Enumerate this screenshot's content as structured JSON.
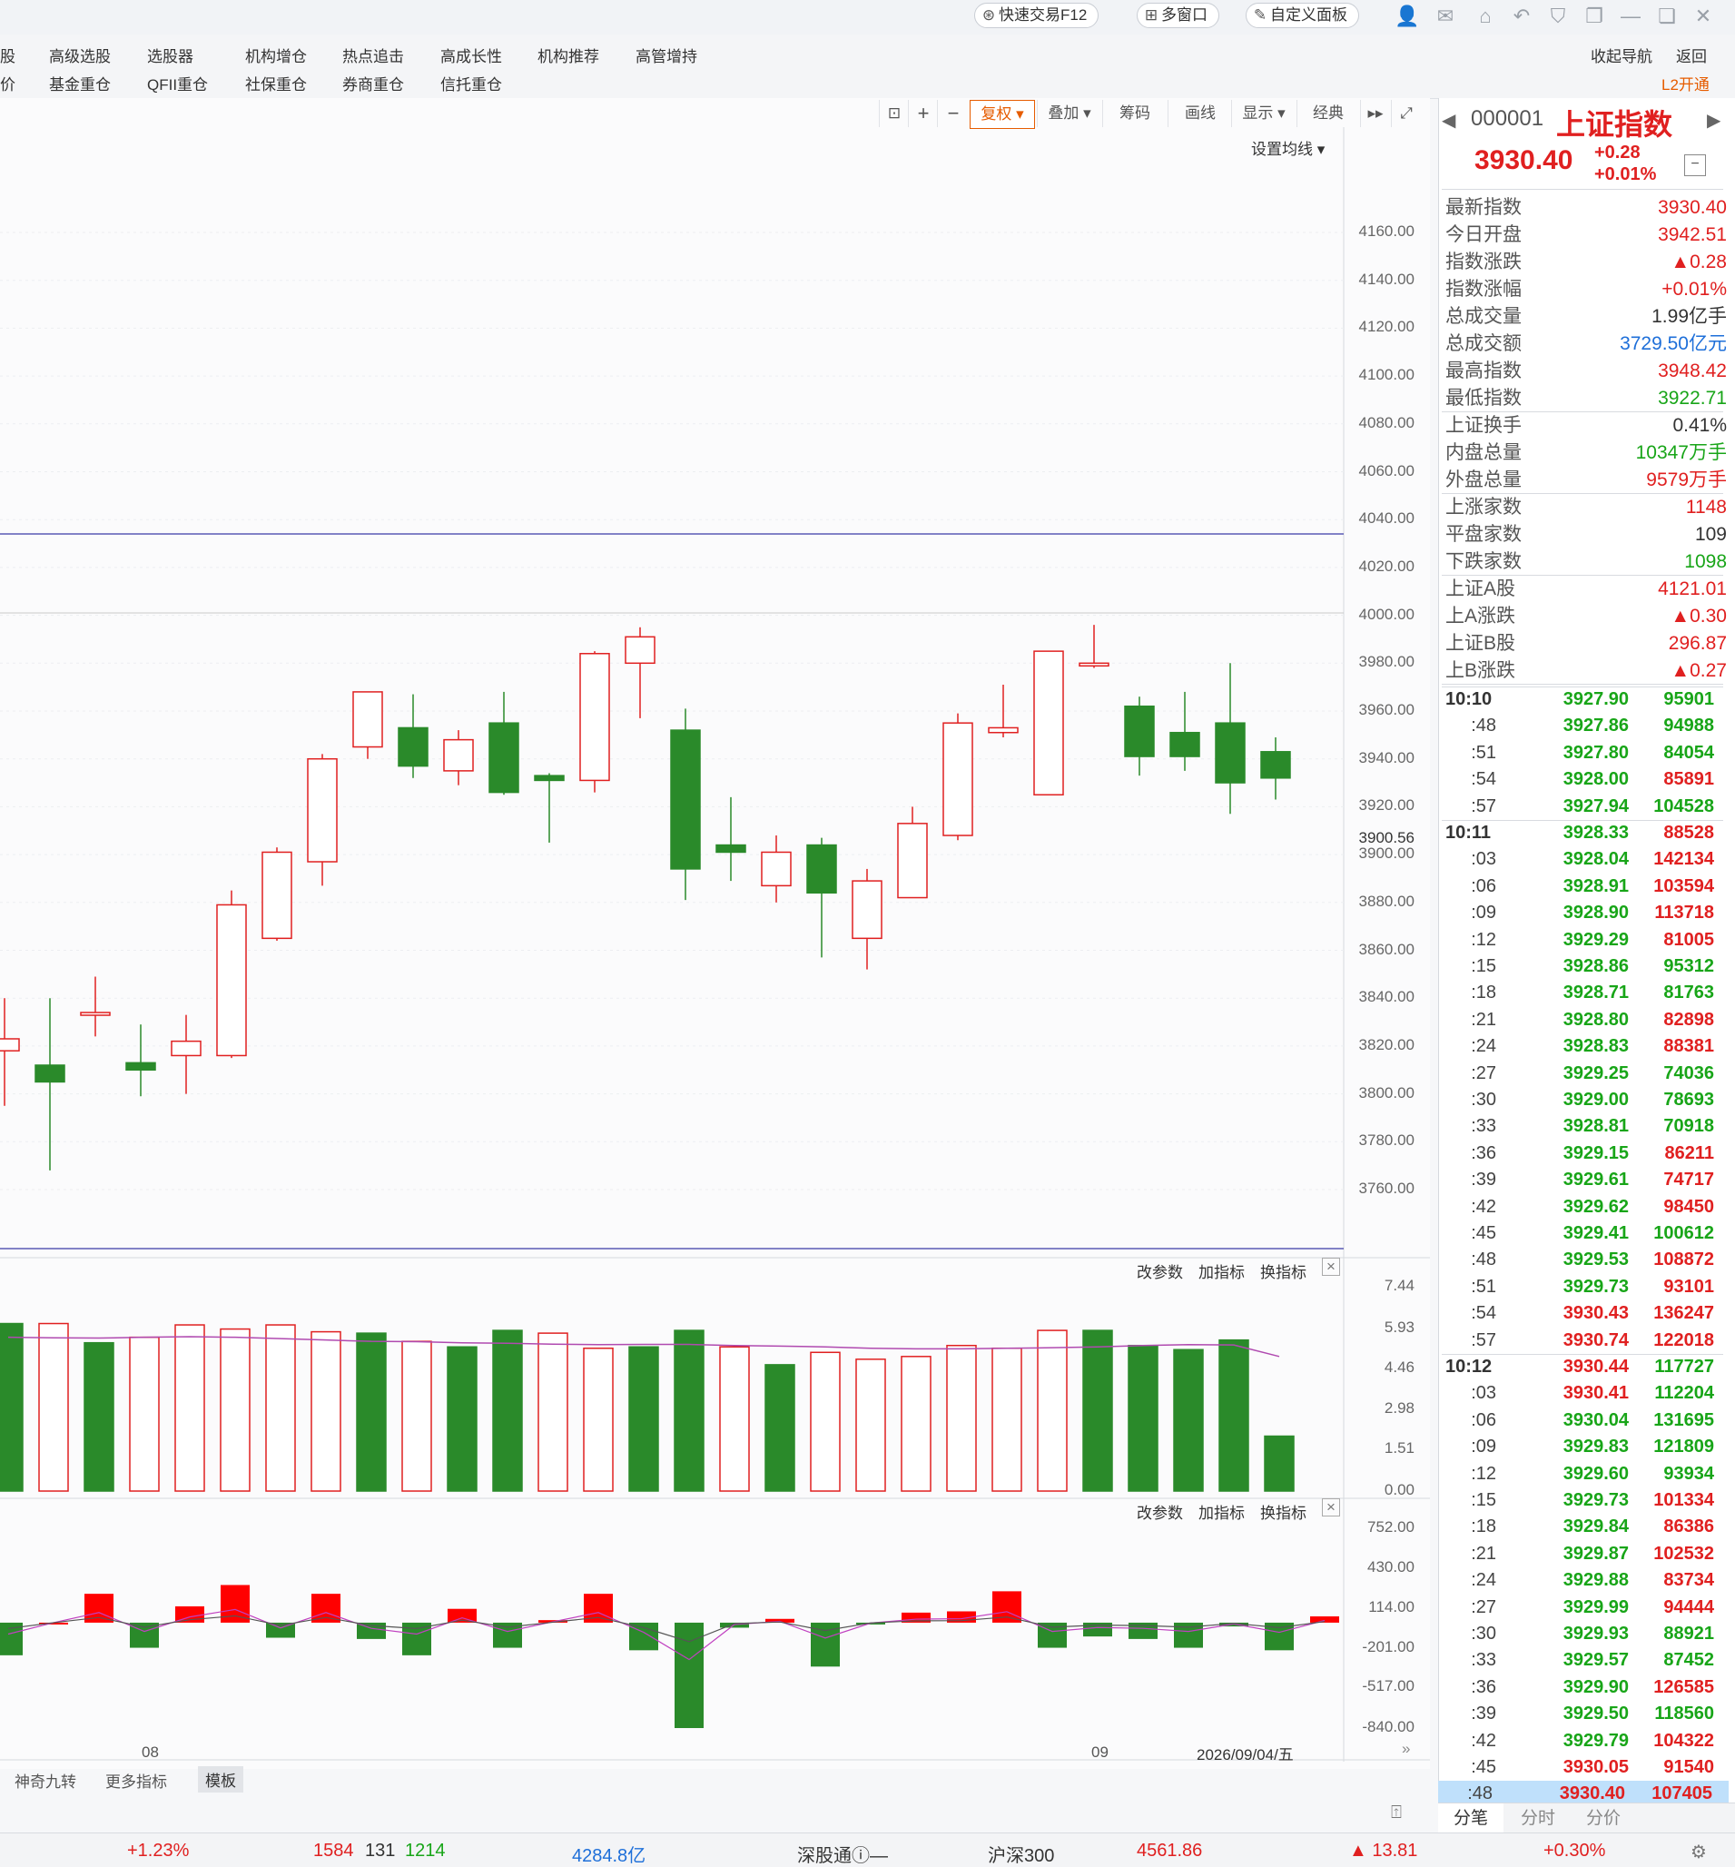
{
  "titlebar": {
    "quick_trade": "快速交易F12",
    "multi_window": "多窗口",
    "custom_panel": "自定义面板"
  },
  "menu": {
    "row1": [
      "股",
      "高级选股",
      "选股器",
      "机构增仓",
      "热点追击",
      "高成长性",
      "机构推荐",
      "高管增持"
    ],
    "row2": [
      "价",
      "基金重仓",
      "QFII重仓",
      "社保重仓",
      "券商重仓",
      "信托重仓"
    ],
    "right1": [
      "收起导航",
      "返回"
    ],
    "l2": "L2开通"
  },
  "toolbar": {
    "fuquan": "复权",
    "diejia": "叠加",
    "chouma": "筹码",
    "huaxian": "画线",
    "xianshi": "显示",
    "jingdian": "经典",
    "set_ma": "设置均线"
  },
  "colors": {
    "up": "#e02020",
    "down": "#2a8a2a",
    "accent": "#e65c00"
  },
  "chart_data": [
    {
      "type": "candlestick",
      "title": "",
      "ylim": [
        3745,
        4170
      ],
      "y_ticks": [
        "4160.00",
        "4140.00",
        "4120.00",
        "4100.00",
        "4080.00",
        "4060.00",
        "4040.00",
        "4020.00",
        "4000.00",
        "3980.00",
        "3960.00",
        "3940.00",
        "3920.00",
        "3900.00",
        "3880.00",
        "3860.00",
        "3840.00",
        "3820.00",
        "3800.00",
        "3780.00",
        "3760.00"
      ],
      "last_price_label": "3900.56",
      "x_labels": [
        "08",
        "09",
        "2026/09/04/五"
      ],
      "candles": [
        {
          "open": 3818,
          "close": 3823,
          "high": 3840,
          "low": 3795
        },
        {
          "open": 3812,
          "close": 3805,
          "high": 3840,
          "low": 3768
        },
        {
          "open": 3834,
          "close": 3834,
          "high": 3849,
          "low": 3824
        },
        {
          "open": 3813,
          "close": 3810,
          "high": 3829,
          "low": 3799
        },
        {
          "open": 3816,
          "close": 3822,
          "high": 3833,
          "low": 3800
        },
        {
          "open": 3816,
          "close": 3879,
          "high": 3885,
          "low": 3815
        },
        {
          "open": 3865,
          "close": 3901,
          "high": 3903,
          "low": 3864
        },
        {
          "open": 3897,
          "close": 3940,
          "high": 3942,
          "low": 3887
        },
        {
          "open": 3945,
          "close": 3968,
          "high": 3968,
          "low": 3940
        },
        {
          "open": 3953,
          "close": 3937,
          "high": 3967,
          "low": 3932
        },
        {
          "open": 3935,
          "close": 3948,
          "high": 3952,
          "low": 3929
        },
        {
          "open": 3955,
          "close": 3926,
          "high": 3968,
          "low": 3925
        },
        {
          "open": 3933,
          "close": 3931,
          "high": 3934,
          "low": 3905
        },
        {
          "open": 3931,
          "close": 3984,
          "high": 3985,
          "low": 3926
        },
        {
          "open": 3980,
          "close": 3991,
          "high": 3995,
          "low": 3957
        },
        {
          "open": 3952,
          "close": 3894,
          "high": 3961,
          "low": 3881
        },
        {
          "open": 3904,
          "close": 3901,
          "high": 3924,
          "low": 3889
        },
        {
          "open": 3887,
          "close": 3901,
          "high": 3908,
          "low": 3880
        },
        {
          "open": 3904,
          "close": 3884,
          "high": 3907,
          "low": 3857
        },
        {
          "open": 3865,
          "close": 3889,
          "high": 3894,
          "low": 3852
        },
        {
          "open": 3882,
          "close": 3913,
          "high": 3920,
          "low": 3882
        },
        {
          "open": 3908,
          "close": 3955,
          "high": 3959,
          "low": 3906
        },
        {
          "open": 3951,
          "close": 3953,
          "high": 3971,
          "low": 3949
        },
        {
          "open": 3925,
          "close": 3985,
          "high": 3985,
          "low": 3925
        },
        {
          "open": 3979,
          "close": 3980,
          "high": 3996,
          "low": 3978
        },
        {
          "open": 3962,
          "close": 3941,
          "high": 3966,
          "low": 3933
        },
        {
          "open": 3951,
          "close": 3941,
          "high": 3968,
          "low": 3935
        },
        {
          "open": 3955,
          "close": 3930,
          "high": 3980,
          "low": 3917
        },
        {
          "open": 3943,
          "close": 3932,
          "high": 3949,
          "low": 3923
        }
      ],
      "hlines": [
        4034,
        4001,
        3760
      ]
    },
    {
      "type": "bar",
      "name": "volume",
      "y_ticks": [
        "7.44",
        "5.93",
        "4.46",
        "2.98",
        "1.51",
        "0.00"
      ],
      "ylim": [
        0,
        7.44
      ],
      "values": [
        5.8,
        6.1,
        6.1,
        5.4,
        5.6,
        6.05,
        5.9,
        6.05,
        5.8,
        5.75,
        5.45,
        5.25,
        5.85,
        5.75,
        5.2,
        5.25,
        5.85,
        5.25,
        4.6,
        5.05,
        4.8,
        4.9,
        5.3,
        5.2,
        5.85,
        5.85,
        5.3,
        5.15,
        5.5,
        2.0
      ],
      "ma": [
        5.6,
        5.6,
        5.58,
        5.57,
        5.6,
        5.62,
        5.6,
        5.55,
        5.5,
        5.45,
        5.44,
        5.4,
        5.38,
        5.35,
        5.33,
        5.34,
        5.34,
        5.3,
        5.28,
        5.25,
        5.2,
        5.18,
        5.18,
        5.2,
        5.22,
        5.25,
        5.3,
        5.33,
        5.32,
        4.9
      ],
      "labels": [
        "改参数",
        "加指标",
        "换指标"
      ]
    },
    {
      "type": "bar",
      "name": "macd",
      "y_ticks": [
        "752.00",
        "430.00",
        "114.00",
        "-201.00",
        "-517.00",
        "-840.00"
      ],
      "ylim": [
        -840,
        752
      ],
      "values": [
        40,
        -260,
        0,
        230,
        -200,
        130,
        300,
        -120,
        230,
        -130,
        -260,
        110,
        -200,
        20,
        230,
        -220,
        -840,
        -40,
        30,
        -350,
        -10,
        80,
        90,
        250,
        -200,
        -110,
        -130,
        -200,
        -30,
        -220,
        50
      ],
      "labels": [
        "改参数",
        "加指标",
        "换指标"
      ]
    }
  ],
  "footer_tabs": [
    "神奇九转",
    "更多指标",
    "模板"
  ],
  "quote": {
    "code": "000001",
    "name": "上证指数",
    "price": "3930.40",
    "change": "+0.28",
    "pct": "+0.01%",
    "rows": [
      {
        "k": "最新指数",
        "v": "3930.40",
        "c": "red"
      },
      {
        "k": "今日开盘",
        "v": "3942.51",
        "c": "red"
      },
      {
        "k": "指数涨跌",
        "v": "▲0.28",
        "c": "red"
      },
      {
        "k": "指数涨幅",
        "v": "+0.01%",
        "c": "red"
      },
      {
        "k": "总成交量",
        "v": "1.99亿手",
        "c": "dark"
      },
      {
        "k": "总成交额",
        "v": "3729.50亿元",
        "c": "blue"
      },
      {
        "k": "最高指数",
        "v": "3948.42",
        "c": "red"
      },
      {
        "k": "最低指数",
        "v": "3922.71",
        "c": "green"
      },
      {
        "k": "上证换手",
        "v": "0.41%",
        "c": "dark"
      },
      {
        "k": "内盘总量",
        "v": "10347万手",
        "c": "green"
      },
      {
        "k": "外盘总量",
        "v": "9579万手",
        "c": "red"
      },
      {
        "k": "上涨家数",
        "v": "1148",
        "c": "red"
      },
      {
        "k": "平盘家数",
        "v": "109",
        "c": "dark"
      },
      {
        "k": "下跌家数",
        "v": "1098",
        "c": "green"
      },
      {
        "k": "上证A股",
        "v": "4121.01",
        "c": "red"
      },
      {
        "k": "上A涨跌",
        "v": "▲0.30",
        "c": "red"
      },
      {
        "k": "上证B股",
        "v": "296.87",
        "c": "red"
      },
      {
        "k": "上B涨跌",
        "v": "▲0.27",
        "c": "red"
      }
    ]
  },
  "ticks": [
    {
      "t": "10:10",
      "p": "3927.90",
      "v": "95901",
      "pc": "green",
      "vc": "green"
    },
    {
      "t": ":48",
      "p": "3927.86",
      "v": "94988",
      "pc": "green",
      "vc": "green"
    },
    {
      "t": ":51",
      "p": "3927.80",
      "v": "84054",
      "pc": "green",
      "vc": "green"
    },
    {
      "t": ":54",
      "p": "3928.00",
      "v": "85891",
      "pc": "green",
      "vc": "red"
    },
    {
      "t": ":57",
      "p": "3927.94",
      "v": "104528",
      "pc": "green",
      "vc": "green"
    },
    {
      "t": "10:11",
      "p": "3928.33",
      "v": "88528",
      "pc": "green",
      "vc": "red"
    },
    {
      "t": ":03",
      "p": "3928.04",
      "v": "142134",
      "pc": "green",
      "vc": "red"
    },
    {
      "t": ":06",
      "p": "3928.91",
      "v": "103594",
      "pc": "green",
      "vc": "red"
    },
    {
      "t": ":09",
      "p": "3928.90",
      "v": "113718",
      "pc": "green",
      "vc": "red"
    },
    {
      "t": ":12",
      "p": "3929.29",
      "v": "81005",
      "pc": "green",
      "vc": "red"
    },
    {
      "t": ":15",
      "p": "3928.86",
      "v": "95312",
      "pc": "green",
      "vc": "green"
    },
    {
      "t": ":18",
      "p": "3928.71",
      "v": "81763",
      "pc": "green",
      "vc": "green"
    },
    {
      "t": ":21",
      "p": "3928.80",
      "v": "82898",
      "pc": "green",
      "vc": "red"
    },
    {
      "t": ":24",
      "p": "3928.83",
      "v": "88381",
      "pc": "green",
      "vc": "red"
    },
    {
      "t": ":27",
      "p": "3929.25",
      "v": "74036",
      "pc": "green",
      "vc": "green"
    },
    {
      "t": ":30",
      "p": "3929.00",
      "v": "78693",
      "pc": "green",
      "vc": "green"
    },
    {
      "t": ":33",
      "p": "3928.81",
      "v": "70918",
      "pc": "green",
      "vc": "green"
    },
    {
      "t": ":36",
      "p": "3929.15",
      "v": "86211",
      "pc": "green",
      "vc": "red"
    },
    {
      "t": ":39",
      "p": "3929.61",
      "v": "74717",
      "pc": "green",
      "vc": "red"
    },
    {
      "t": ":42",
      "p": "3929.62",
      "v": "98450",
      "pc": "green",
      "vc": "red"
    },
    {
      "t": ":45",
      "p": "3929.41",
      "v": "100612",
      "pc": "green",
      "vc": "green"
    },
    {
      "t": ":48",
      "p": "3929.53",
      "v": "108872",
      "pc": "green",
      "vc": "red"
    },
    {
      "t": ":51",
      "p": "3929.73",
      "v": "93101",
      "pc": "green",
      "vc": "red"
    },
    {
      "t": ":54",
      "p": "3930.43",
      "v": "136247",
      "pc": "red",
      "vc": "red"
    },
    {
      "t": ":57",
      "p": "3930.74",
      "v": "122018",
      "pc": "red",
      "vc": "red"
    },
    {
      "t": "10:12",
      "p": "3930.44",
      "v": "117727",
      "pc": "red",
      "vc": "green"
    },
    {
      "t": ":03",
      "p": "3930.41",
      "v": "112204",
      "pc": "red",
      "vc": "green"
    },
    {
      "t": ":06",
      "p": "3930.04",
      "v": "131695",
      "pc": "green",
      "vc": "green"
    },
    {
      "t": ":09",
      "p": "3929.83",
      "v": "121809",
      "pc": "green",
      "vc": "green"
    },
    {
      "t": ":12",
      "p": "3929.60",
      "v": "93934",
      "pc": "green",
      "vc": "green"
    },
    {
      "t": ":15",
      "p": "3929.73",
      "v": "101334",
      "pc": "green",
      "vc": "red"
    },
    {
      "t": ":18",
      "p": "3929.84",
      "v": "86386",
      "pc": "green",
      "vc": "red"
    },
    {
      "t": ":21",
      "p": "3929.87",
      "v": "102532",
      "pc": "green",
      "vc": "red"
    },
    {
      "t": ":24",
      "p": "3929.88",
      "v": "83734",
      "pc": "green",
      "vc": "red"
    },
    {
      "t": ":27",
      "p": "3929.99",
      "v": "94444",
      "pc": "green",
      "vc": "red"
    },
    {
      "t": ":30",
      "p": "3929.93",
      "v": "88921",
      "pc": "green",
      "vc": "green"
    },
    {
      "t": ":33",
      "p": "3929.57",
      "v": "87452",
      "pc": "green",
      "vc": "green"
    },
    {
      "t": ":36",
      "p": "3929.90",
      "v": "126585",
      "pc": "green",
      "vc": "red"
    },
    {
      "t": ":39",
      "p": "3929.50",
      "v": "118560",
      "pc": "green",
      "vc": "green"
    },
    {
      "t": ":42",
      "p": "3929.79",
      "v": "104322",
      "pc": "green",
      "vc": "red"
    },
    {
      "t": ":45",
      "p": "3930.05",
      "v": "91540",
      "pc": "red",
      "vc": "red"
    },
    {
      "t": ":48",
      "p": "3930.40",
      "v": "107405",
      "pc": "red",
      "vc": "red"
    }
  ],
  "bottom_tabs": [
    "分笔",
    "分时",
    "分价"
  ],
  "statusbar": {
    "pct1": "+1.23%",
    "n1": "1584",
    "n2": "131",
    "n3": "1214",
    "amount": "4284.8亿",
    "sgt": "深股通",
    "sgt_val": "—",
    "hs300": "沪深300",
    "hs300_val": "4561.86",
    "hs300_chg": "▲ 13.81",
    "hs300_pct": "+0.30%"
  }
}
